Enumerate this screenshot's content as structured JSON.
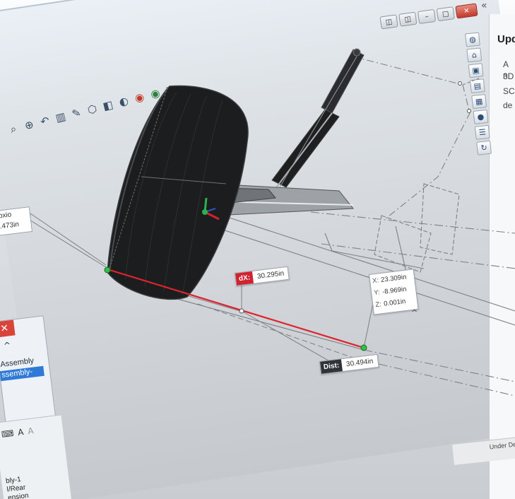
{
  "window": {
    "controls": [
      "◫",
      "◫",
      "–",
      "□",
      "✕"
    ],
    "collapse_glyph": "«"
  },
  "task_pane": {
    "title": "Upd",
    "lines": [
      "A n",
      "3D",
      "SC",
      "de"
    ],
    "icons": [
      "globe-icon",
      "home-icon",
      "box-icon",
      "folder-icon",
      "palette-icon",
      "color-icon",
      "list-icon",
      "refresh-icon"
    ]
  },
  "hud_toolbar": {
    "icons": [
      "zoom-to-fit-icon",
      "zoom-area-icon",
      "previous-view-icon",
      "section-view-icon",
      "dynamic-annotation-icon",
      "view-orientation-icon",
      "display-style-icon",
      "hide-show-icon",
      "appearance-icon",
      "scenes-icon",
      "view-settings-icon"
    ]
  },
  "left_panel": {
    "close_glyph": "✕",
    "collapse_glyph": "^",
    "items": [
      "Assembly",
      "ssembly-"
    ],
    "selected_index": 1
  },
  "left_bottom": {
    "tree_lines": [
      "bly-1",
      "l/Rear",
      "ension"
    ]
  },
  "status_bar": {
    "text": "Under Def"
  },
  "measurements": {
    "dx": {
      "label": "dX:",
      "value": "30.295in"
    },
    "dist": {
      "label": "Dist:",
      "value": "30.494in"
    },
    "xyz": {
      "x_label": "X:",
      "x_value": "23.309in",
      "y_label": "Y:",
      "y_value": "-8.969in",
      "z_label": "Z:",
      "z_value": "0.001in"
    },
    "left_partial": {
      "line1": "oxio",
      "line2": ".473in"
    }
  }
}
